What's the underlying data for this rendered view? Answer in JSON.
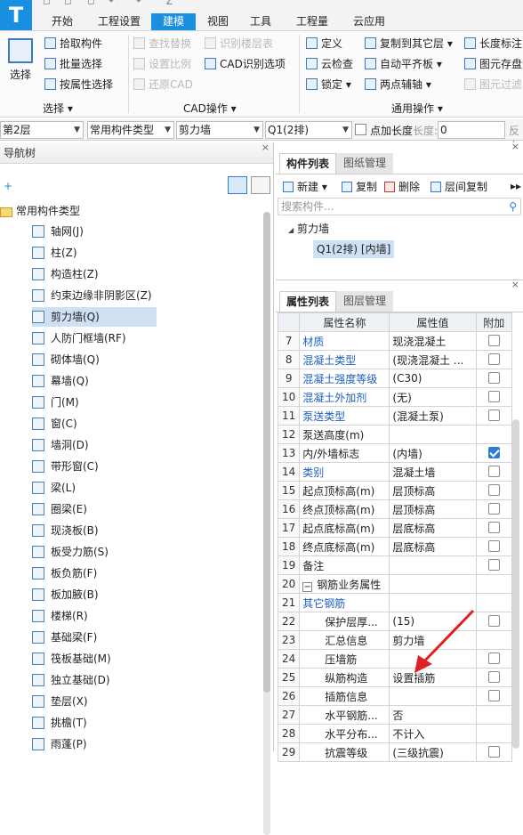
{
  "app": {
    "logo": "T"
  },
  "menu_tabs": [
    "开始",
    "工程设置",
    "建模",
    "视图",
    "工具",
    "工程量",
    "云应用"
  ],
  "ribbon": {
    "select_big": "选择",
    "select_items": [
      "拾取构件",
      "批量选择",
      "按属性选择"
    ],
    "select_group": "选择",
    "cad_items": [
      "查找替换",
      "识别楼层表",
      "设置比例",
      "CAD识别选项",
      "还原CAD"
    ],
    "cad_group": "CAD操作",
    "general_items": [
      "定义",
      "复制到其它层",
      "长度标注",
      "云检查",
      "自动平齐板",
      "图元存盘",
      "锁定",
      "两点辅轴",
      "图元过滤"
    ],
    "general_group": "通用操作"
  },
  "filters": {
    "floor": "第2层",
    "type": "常用构件类型",
    "component": "剪力墙",
    "instance": "Q1(2排)",
    "point_length": "点加长度",
    "length_label": "长度:",
    "length_value": "0",
    "reverse": "反向"
  },
  "nav": {
    "title": "导航树",
    "root": "常用构件类型",
    "items": [
      "轴网(J)",
      "柱(Z)",
      "构造柱(Z)",
      "约束边缘非阴影区(Z)",
      "剪力墙(Q)",
      "人防门框墙(RF)",
      "砌体墙(Q)",
      "幕墙(Q)",
      "门(M)",
      "窗(C)",
      "墙洞(D)",
      "带形窗(C)",
      "梁(L)",
      "圈梁(E)",
      "现浇板(B)",
      "板受力筋(S)",
      "板负筋(F)",
      "板加腋(B)",
      "楼梯(R)",
      "基础梁(F)",
      "筏板基础(M)",
      "独立基础(D)",
      "垫层(X)",
      "挑檐(T)",
      "雨蓬(P)"
    ]
  },
  "component_list": {
    "tab_active": "构件列表",
    "tab_inactive": "图纸管理",
    "toolbar": [
      "新建",
      "复制",
      "删除",
      "层间复制"
    ],
    "search_placeholder": "搜索构件...",
    "group": "剪力墙",
    "selected": "Q1(2排) [内墙]"
  },
  "properties": {
    "tab_active": "属性列表",
    "tab_inactive": "图层管理",
    "headers": [
      "属性名称",
      "属性值",
      "附加"
    ],
    "rows": [
      {
        "n": "7",
        "name": "材质",
        "value": "现浇混凝土"
      },
      {
        "n": "8",
        "name": "混凝土类型",
        "value": "(现浇混凝土 ..."
      },
      {
        "n": "9",
        "name": "混凝土强度等级",
        "value": "(C30)"
      },
      {
        "n": "10",
        "name": "混凝土外加剂",
        "value": "(无)"
      },
      {
        "n": "11",
        "name": "泵送类型",
        "value": "(混凝土泵)"
      },
      {
        "n": "12",
        "name": "泵送高度(m)",
        "value": ""
      },
      {
        "n": "13",
        "name": "内/外墙标志",
        "value": "(内墙)"
      },
      {
        "n": "14",
        "name": "类别",
        "value": "混凝土墙"
      },
      {
        "n": "15",
        "name": "起点顶标高(m)",
        "value": "层顶标高"
      },
      {
        "n": "16",
        "name": "终点顶标高(m)",
        "value": "层顶标高"
      },
      {
        "n": "17",
        "name": "起点底标高(m)",
        "value": "层底标高"
      },
      {
        "n": "18",
        "name": "终点底标高(m)",
        "value": "层底标高"
      },
      {
        "n": "19",
        "name": "备注",
        "value": ""
      },
      {
        "n": "20",
        "name": "钢筋业务属性",
        "value": ""
      },
      {
        "n": "21",
        "name": "其它钢筋",
        "value": ""
      },
      {
        "n": "22",
        "name": "保护层厚...",
        "value": "(15)"
      },
      {
        "n": "23",
        "name": "汇总信息",
        "value": "剪力墙"
      },
      {
        "n": "24",
        "name": "压墙筋",
        "value": ""
      },
      {
        "n": "25",
        "name": "纵筋构造",
        "value": "设置插筋"
      },
      {
        "n": "26",
        "name": "插筋信息",
        "value": ""
      },
      {
        "n": "27",
        "name": "水平钢筋...",
        "value": "否"
      },
      {
        "n": "28",
        "name": "水平分布...",
        "value": "不计入"
      },
      {
        "n": "29",
        "name": "抗震等级",
        "value": "(三级抗震)"
      }
    ]
  }
}
